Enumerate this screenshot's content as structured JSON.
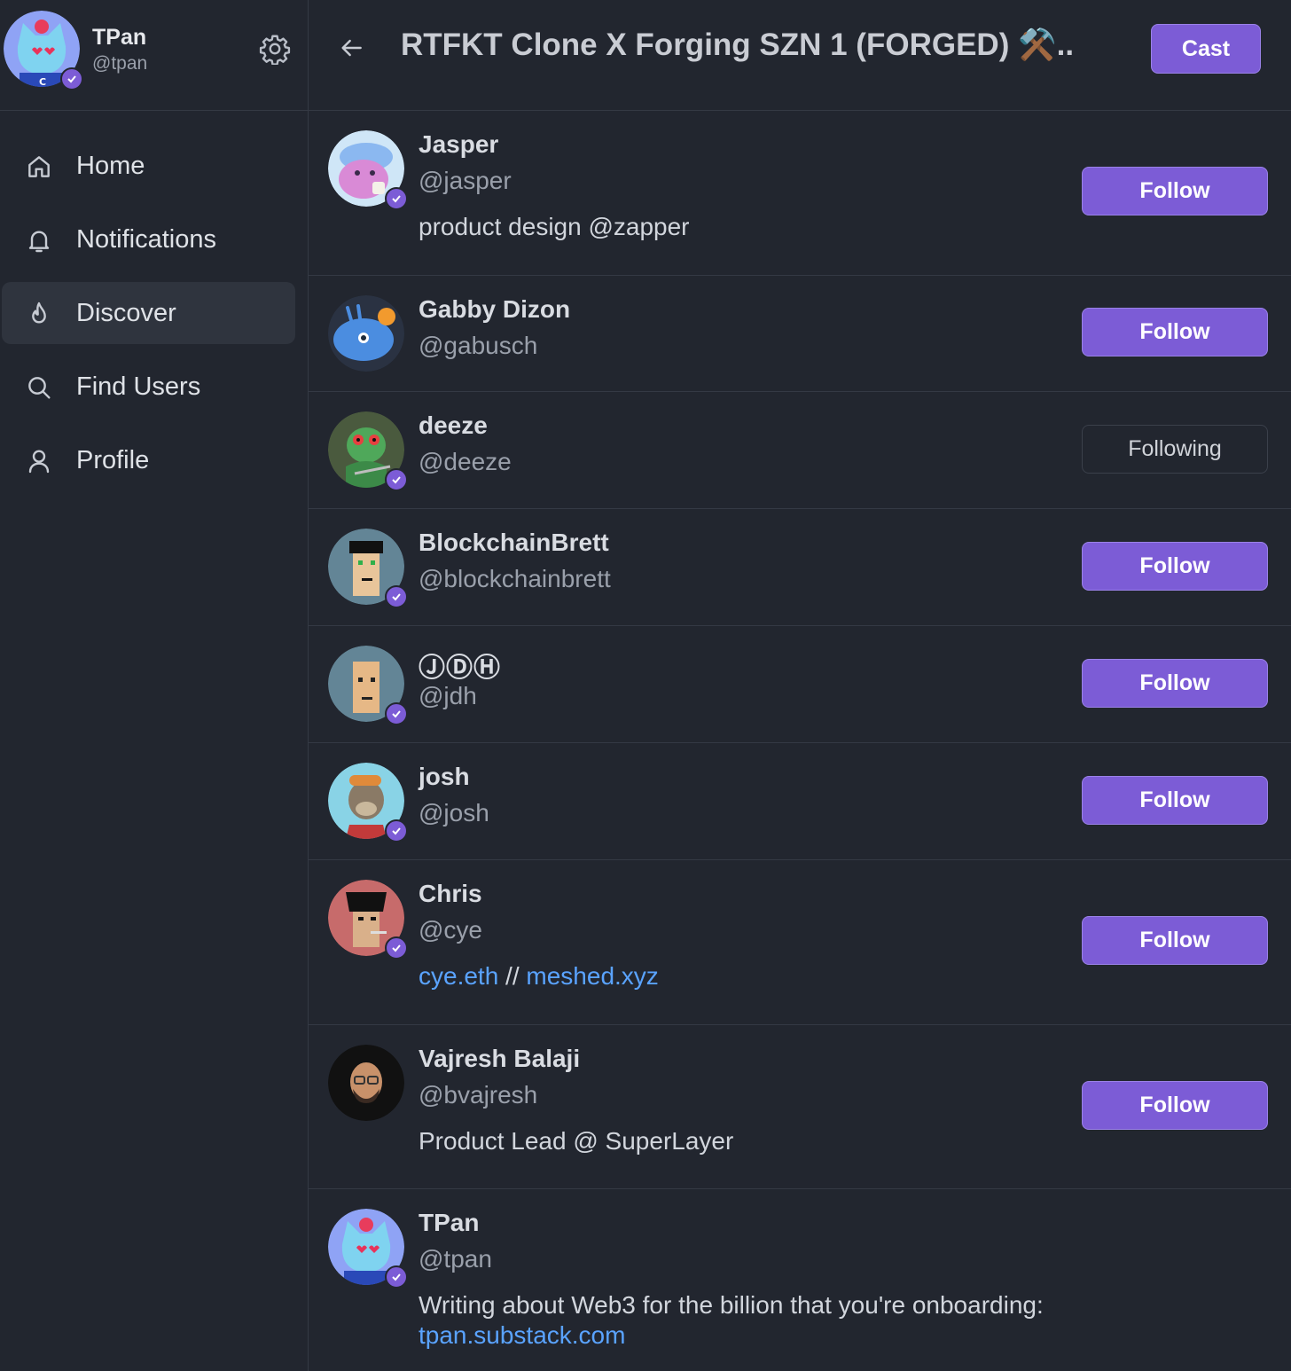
{
  "me": {
    "name": "TPan",
    "handle": "@tpan",
    "avatar_icon": "blue-cat-avatar"
  },
  "nav": {
    "items": [
      {
        "label": "Home",
        "icon": "home-icon"
      },
      {
        "label": "Notifications",
        "icon": "bell-icon"
      },
      {
        "label": "Discover",
        "icon": "flame-icon",
        "active": true
      },
      {
        "label": "Find Users",
        "icon": "search-icon"
      },
      {
        "label": "Profile",
        "icon": "user-icon"
      }
    ]
  },
  "header": {
    "title": "RTFKT Clone X Forging SZN 1 (FORGED) ⚒️...",
    "cast_label": "Cast"
  },
  "colors": {
    "accent": "#7c5cd6",
    "background": "#22262f",
    "link": "#5aa3ff"
  },
  "users": [
    {
      "name": "Jasper",
      "handle": "@jasper",
      "bio": "product design @zapper",
      "button": "Follow",
      "following": false,
      "verified": true
    },
    {
      "name": "Gabby Dizon",
      "handle": "@gabusch",
      "bio": "",
      "button": "Follow",
      "following": false,
      "verified": false
    },
    {
      "name": "deeze",
      "handle": "@deeze",
      "bio": "",
      "button": "Following",
      "following": true,
      "verified": true
    },
    {
      "name": "BlockchainBrett",
      "handle": "@blockchainbrett",
      "bio": "",
      "button": "Follow",
      "following": false,
      "verified": true
    },
    {
      "name": "ⒿⒹⒽ",
      "handle": "@jdh",
      "bio": "",
      "button": "Follow",
      "following": false,
      "verified": true
    },
    {
      "name": "josh",
      "handle": "@josh",
      "bio": "",
      "button": "Follow",
      "following": false,
      "verified": true
    },
    {
      "name": "Chris",
      "handle": "@cye",
      "bio_link1": "cye.eth",
      "bio_sep": " // ",
      "bio_link2": "meshed.xyz",
      "button": "Follow",
      "following": false,
      "verified": true
    },
    {
      "name": "Vajresh Balaji",
      "handle": "@bvajresh",
      "bio": "Product Lead @ SuperLayer",
      "button": "Follow",
      "following": false,
      "verified": false
    },
    {
      "name": "TPan",
      "handle": "@tpan",
      "bio": "Writing about Web3 for the billion that you're onboarding:",
      "bio_link": "tpan.substack.com",
      "button": "",
      "following": false,
      "verified": true
    }
  ]
}
